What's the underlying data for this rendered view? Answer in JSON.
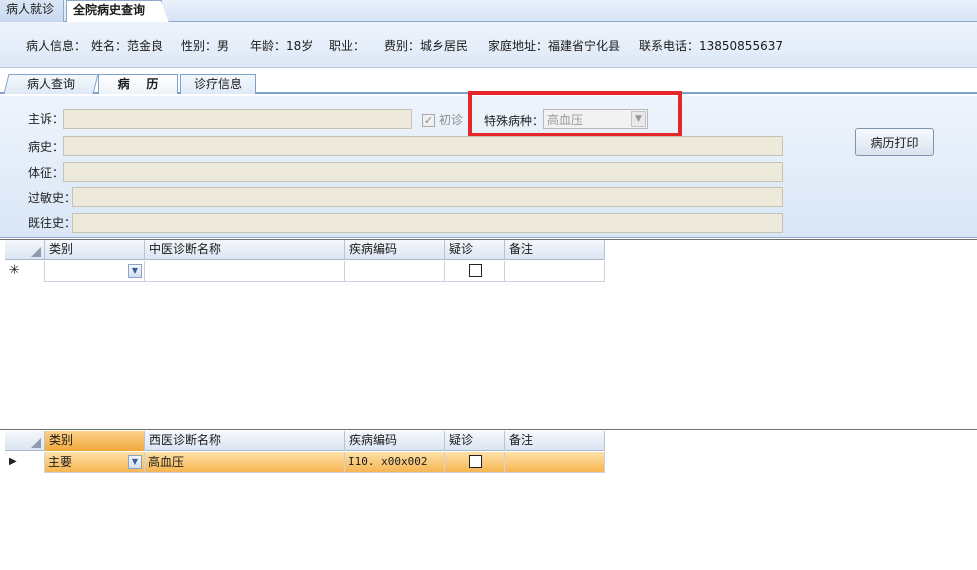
{
  "top_tabs": [
    {
      "label": "病人就诊",
      "active": false
    },
    {
      "label": "全院病史查询",
      "active": true
    }
  ],
  "patient_info": {
    "section_label": "病人信息：",
    "name": "姓名：范金良",
    "gender": "性别：男",
    "age": "年龄：18岁",
    "occupation": "职业：",
    "fee_type": "费别：城乡居民",
    "address": "家庭地址：福建省宁化县",
    "phone": "联系电话：13850855637"
  },
  "inner_tabs": [
    {
      "label": "病人查询"
    },
    {
      "label": "病    历"
    },
    {
      "label": "诊疗信息"
    }
  ],
  "form": {
    "chief_complaint_label": "主诉：",
    "chief_complaint_value": "",
    "first_visit_label": "初诊",
    "first_visit_checked": true,
    "special_disease_label": "特殊病种：",
    "special_disease_value": "高血压",
    "history_label": "病史：",
    "history_value": "",
    "sign_label": "体征：",
    "sign_value": "",
    "allergy_label": "过敏史：",
    "allergy_value": "",
    "past_history_label": "既往史：",
    "past_history_value": "",
    "print_button": "病历打印"
  },
  "tcm_grid": {
    "columns": [
      "类别",
      "中医诊断名称",
      "疾病编码",
      "疑诊",
      "备注"
    ],
    "rows": [
      {
        "indicator": "✳",
        "category": "",
        "name": "",
        "code": "",
        "suspected": false,
        "note": ""
      }
    ]
  },
  "western_grid": {
    "columns": [
      "类别",
      "西医诊断名称",
      "疾病编码",
      "疑诊",
      "备注"
    ],
    "rows": [
      {
        "indicator": "▶",
        "category": "主要",
        "name": "高血压",
        "code": "I10. x00x002",
        "suspected": false,
        "note": ""
      }
    ]
  },
  "colors": {
    "highlight_box": "#e5262b",
    "selected_row": "#f7b552",
    "panel_bg": "#dde8f6"
  }
}
